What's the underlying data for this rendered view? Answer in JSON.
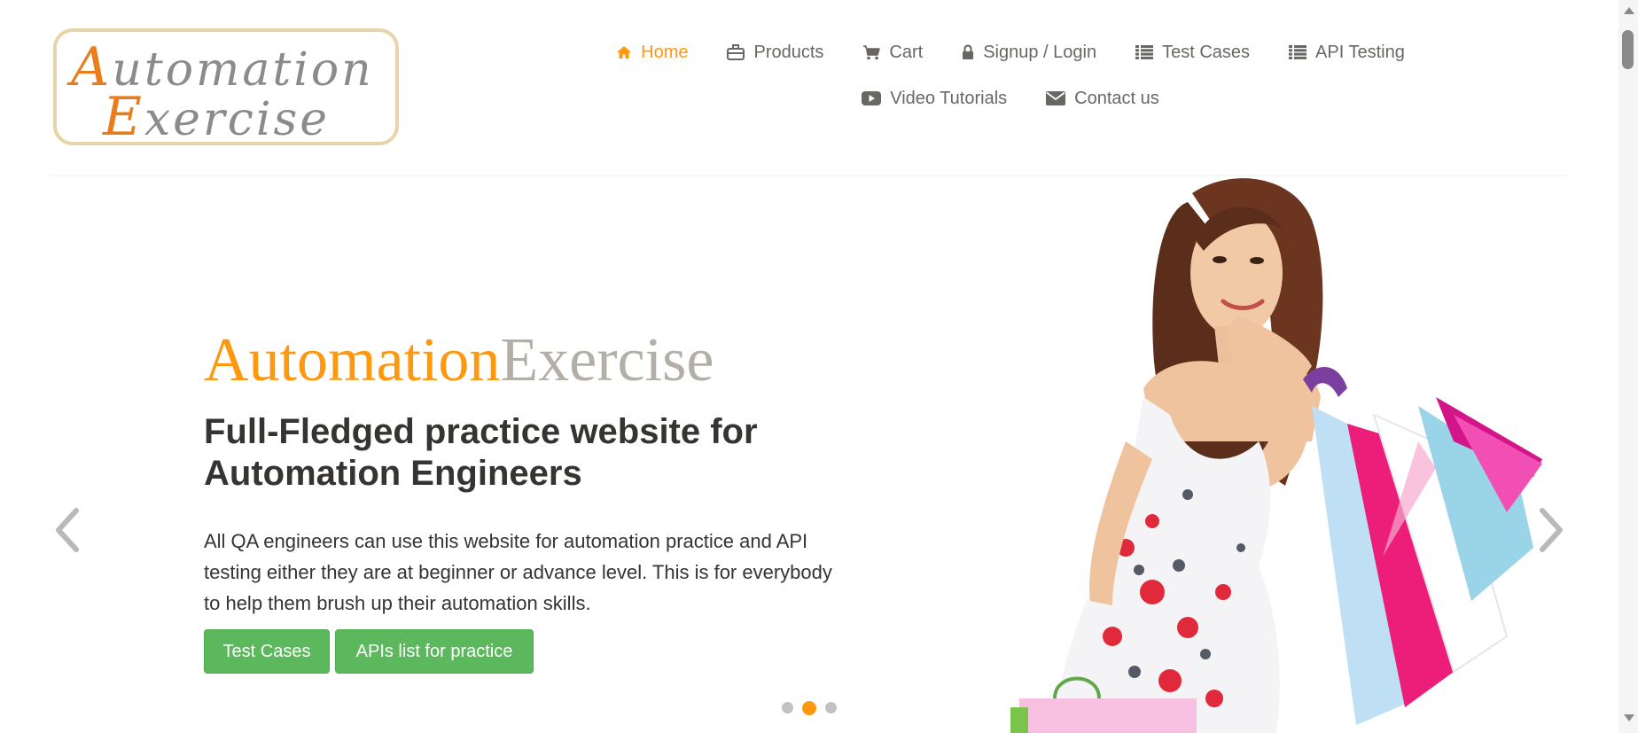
{
  "logo": {
    "line1_cap": "A",
    "line1_rest": "utomation",
    "line2_cap": "E",
    "line2_rest": "xercise"
  },
  "nav": {
    "items": [
      {
        "label": "Home",
        "icon": "home-icon",
        "active": true
      },
      {
        "label": "Products",
        "icon": "briefcase-icon"
      },
      {
        "label": "Cart",
        "icon": "cart-icon"
      },
      {
        "label": "Signup / Login",
        "icon": "lock-icon"
      },
      {
        "label": "Test Cases",
        "icon": "list-icon"
      },
      {
        "label": "API Testing",
        "icon": "list-icon"
      },
      {
        "label": "Video Tutorials",
        "icon": "youtube-play-icon"
      },
      {
        "label": "Contact us",
        "icon": "envelope-icon"
      }
    ]
  },
  "hero": {
    "title_part1": "Automation",
    "title_part2": "Exercise",
    "heading": "Full-Fledged practice website for Automation Engineers",
    "text": "All QA engineers can use this website for automation practice and API testing either they are at beginner or advance level. This is for everybody to help them brush up their automation skills.",
    "buttons": {
      "test_cases": "Test Cases",
      "apis_list": "APIs list for practice"
    },
    "slide_count": 3,
    "active_slide": 2
  },
  "colors": {
    "accent": "#FE980F",
    "button_green": "#5cb85c",
    "nav_text": "#696763",
    "heading_text": "#363432"
  }
}
